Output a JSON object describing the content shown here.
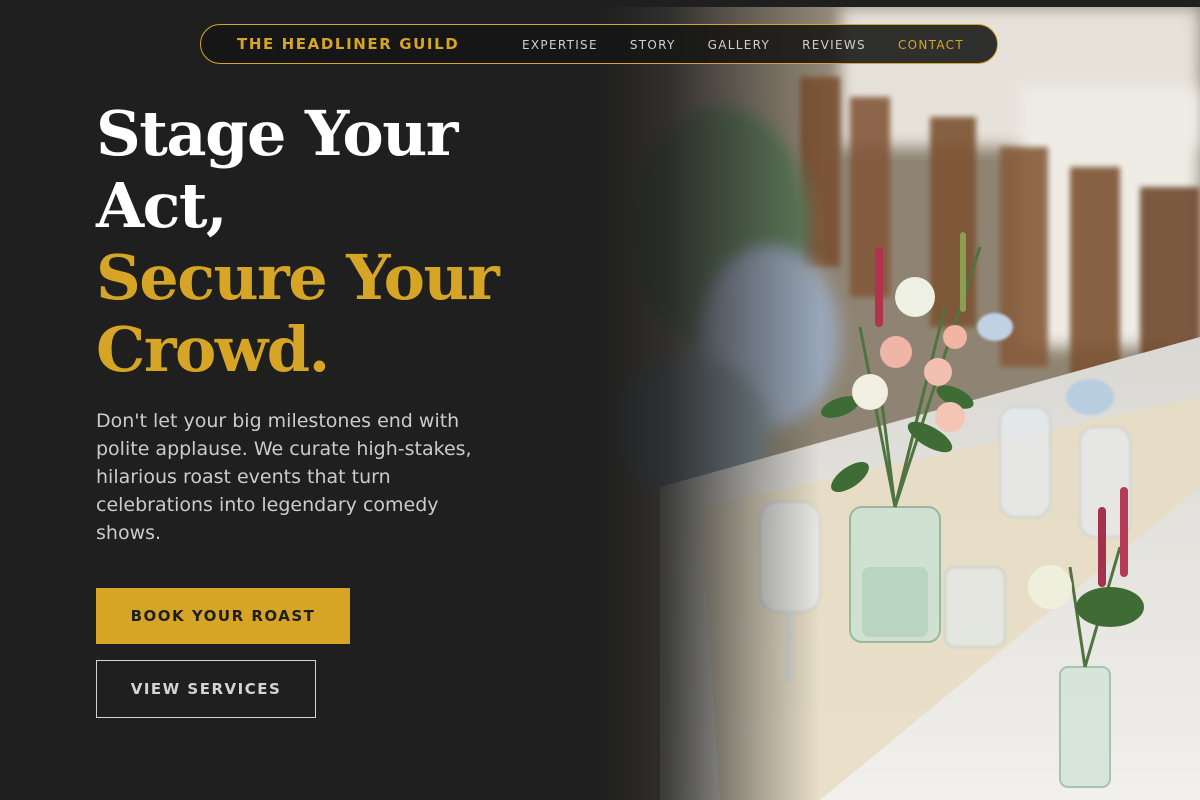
{
  "nav": {
    "brand": "THE HEADLINER GUILD",
    "links": [
      {
        "label": "EXPERTISE"
      },
      {
        "label": "STORY"
      },
      {
        "label": "GALLERY"
      },
      {
        "label": "REVIEWS"
      },
      {
        "label": "CONTACT"
      }
    ]
  },
  "hero": {
    "headline_line1": "Stage Your",
    "headline_line2": "Act,",
    "headline_line3": "Secure Your",
    "headline_line4": "Crowd.",
    "description": "Don't let your big milestones end with polite applause. We curate high-stakes, hilarious roast events that turn celebrations into legendary comedy shows.",
    "primary_button": "BOOK YOUR ROAST",
    "secondary_button": "VIEW SERVICES",
    "image_semantic": "banquet-table-with-flowers-photo"
  },
  "colors": {
    "background": "#1f1f1f",
    "accent": "#d7a526",
    "text_light": "#ffffff",
    "text_muted": "#cbcbcb"
  }
}
